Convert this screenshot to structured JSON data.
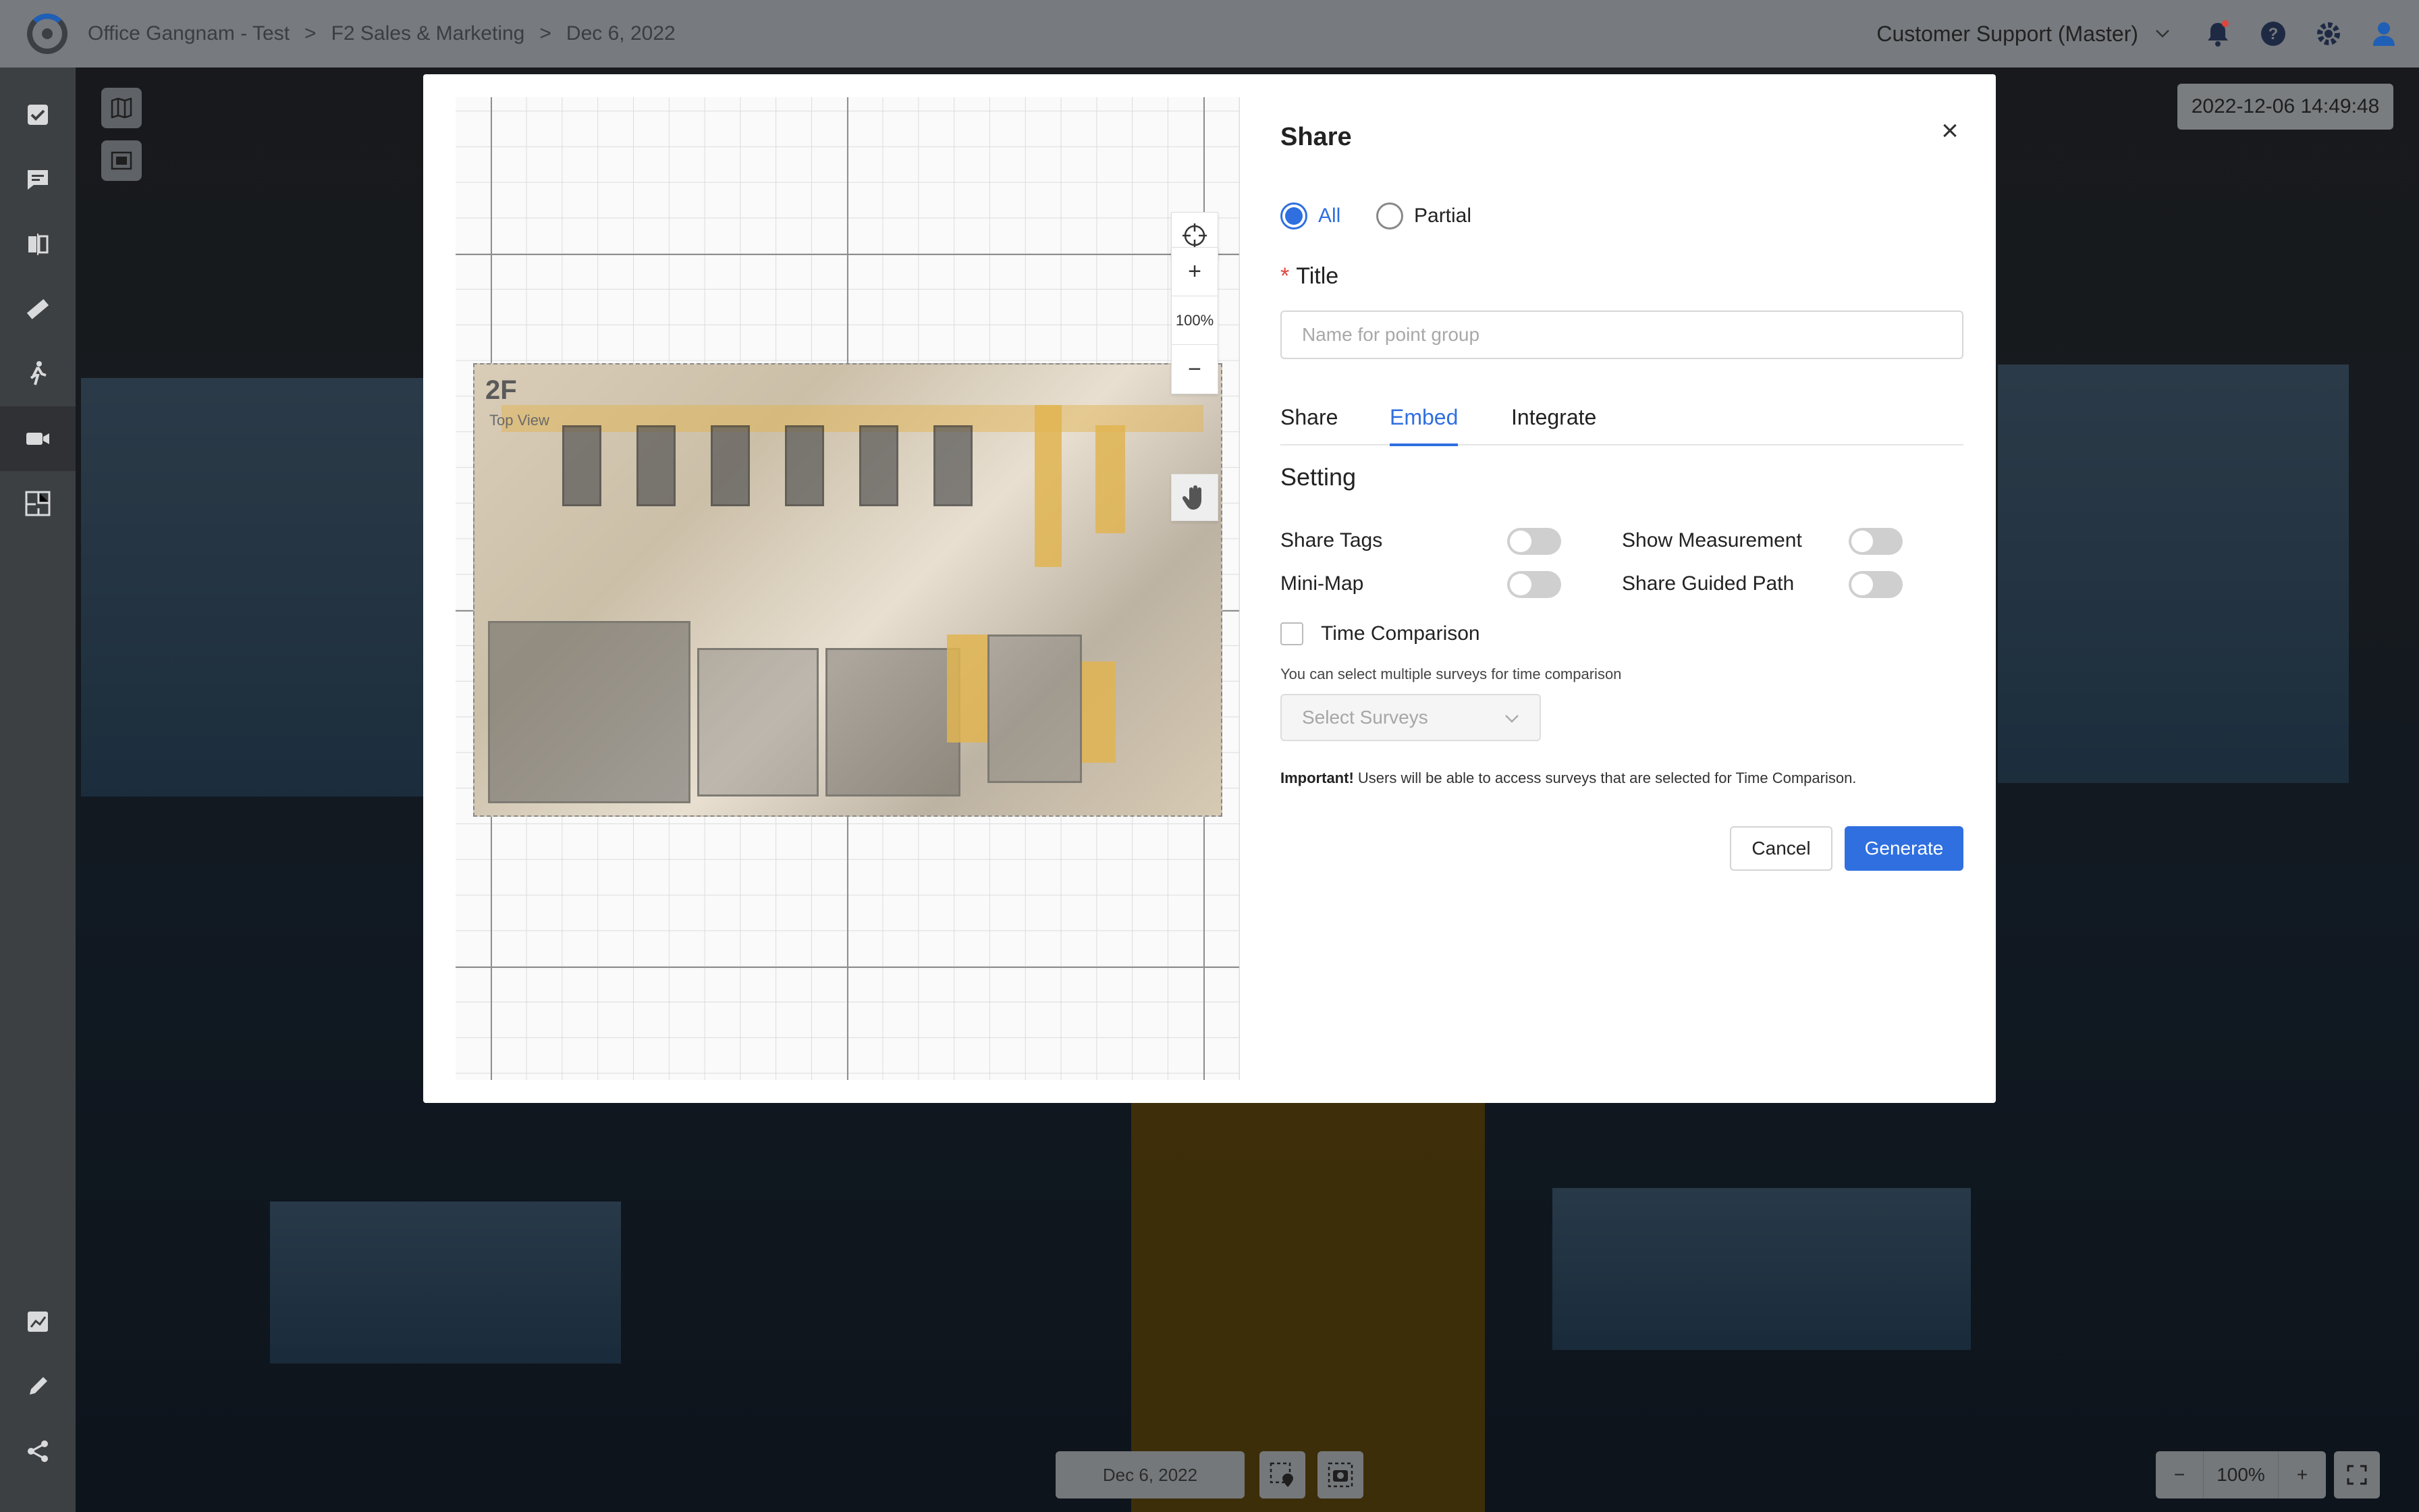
{
  "header": {
    "breadcrumbs": [
      "Office Gangnam - Test",
      "F2 Sales & Marketing",
      "Dec 6, 2022"
    ],
    "breadcrumb_separator": ">",
    "workspace": "Customer Support (Master)"
  },
  "icons": {
    "logo": "logo-icon",
    "sidebar": [
      "checklist-icon",
      "comment-icon",
      "compare-icon",
      "ruler-icon",
      "walk-icon",
      "video-icon",
      "floorplan-icon",
      "chart-icon",
      "pencil-icon",
      "share-icon"
    ],
    "header": [
      "chevron-down-icon",
      "bell-icon",
      "help-icon",
      "gear-icon",
      "user-icon"
    ]
  },
  "viewer": {
    "timestamp": "2022-12-06 14:49:48",
    "date": "Dec 6, 2022",
    "zoom": "100%",
    "zoom_minus": "−",
    "zoom_plus": "+"
  },
  "map": {
    "floor_label": "2F",
    "floor_sublabel": "Top View",
    "zoom": "100%",
    "zoom_in": "+",
    "zoom_out": "−"
  },
  "share": {
    "title": "Share",
    "close": "×",
    "scope_options": [
      "All",
      "Partial"
    ],
    "scope_selected": "All",
    "title_field": {
      "required_mark": "*",
      "label": "Title",
      "placeholder": "Name for point group",
      "value": ""
    },
    "tabs": [
      "Share",
      "Embed",
      "Integrate"
    ],
    "active_tab": "Embed",
    "setting_heading": "Setting",
    "toggles": [
      {
        "label": "Share Tags",
        "on": false
      },
      {
        "label": "Show Measurement",
        "on": false
      },
      {
        "label": "Mini-Map",
        "on": false
      },
      {
        "label": "Share Guided Path",
        "on": false
      }
    ],
    "time_comparison": {
      "label": "Time Comparison",
      "checked": false,
      "hint": "You can select multiple surveys for time comparison",
      "select_placeholder": "Select Surveys"
    },
    "important_prefix": "Important!",
    "important_text": "Users will be able to access surveys that are selected for Time Comparison.",
    "cancel": "Cancel",
    "generate": "Generate"
  },
  "colors": {
    "accent": "#2f6fe0",
    "required": "#e2443b",
    "topbar": "#777a7e",
    "sidebar": "#3d4043"
  }
}
